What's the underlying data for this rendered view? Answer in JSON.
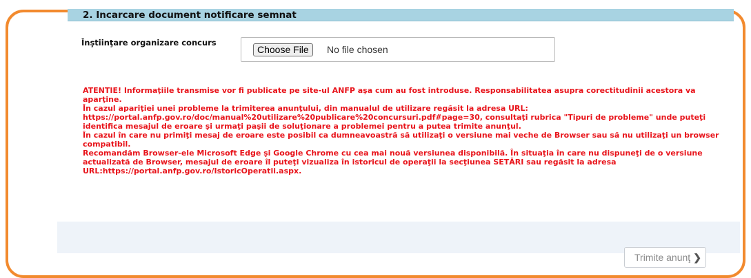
{
  "section": {
    "title": "2. Incarcare document notificare semnat"
  },
  "form": {
    "label": "Înştiinţare organizare concurs",
    "file_button": "Choose File",
    "file_status": "No file chosen"
  },
  "warning": {
    "line1": "ATENTIE! Informaţiile transmise vor fi publicate pe site-ul ANFP aşa cum au fost introduse. Responsabilitatea asupra corectitudinii acestora va aparţine.",
    "line2": "În cazul apariţiei unei probleme la trimiterea anunţului, din manualul de utilizare regăsit la adresa URL: https://portal.anfp.gov.ro/doc/manual%20utilizare%20publicare%20concursuri.pdf#page=30, consultaţi rubrica \"Tipuri de probleme\" unde puteţi identifica mesajul de eroare şi urmaţi paşii de soluţionare a problemei pentru a putea trimite anunţul.",
    "line3": "În cazul în care nu primiţi mesaj de eroare este posibil ca dumneavoastră să utilizaţi o versiune mai veche de Browser sau să nu utilizaţi un browser compatibil.",
    "line4": "Recomandăm Browser-ele Microsoft Edge şi Google Chrome cu cea mai nouă versiunea disponibilă. În situaţia în care nu dispuneţi de o versiune actualizată de Browser, mesajul de eroare îl puteţi vizualiza în istoricul de operaţii la secţiunea SETĂRI sau regăsit la adresa URL:https://portal.anfp.gov.ro/IstoricOperatii.aspx."
  },
  "footer": {
    "submit_label": "Trimite anunţ",
    "submit_icon": "chevron-right-icon"
  },
  "colors": {
    "frame": "#f28a2e",
    "header": "#a8d3e2",
    "warning": "#e8141b",
    "footer_bg": "#eef3f9"
  }
}
